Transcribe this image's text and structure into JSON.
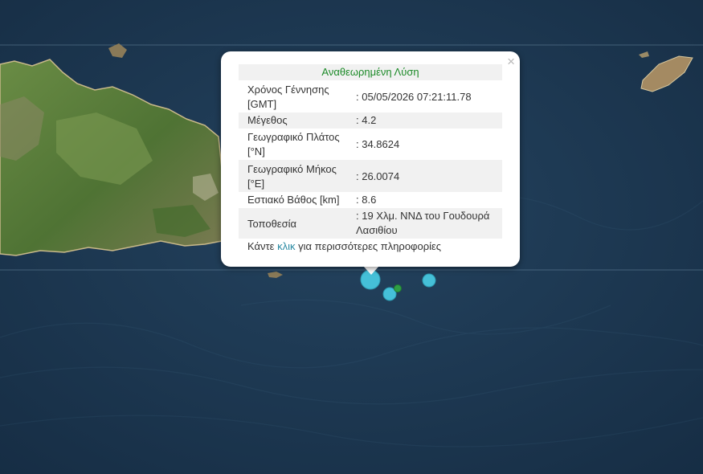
{
  "popup": {
    "title": "Αναθεωρημένη Λύση",
    "close_symbol": "×",
    "rows": [
      {
        "label": "Χρόνος Γέννησης [GMT]",
        "value": ": 05/05/2026 07:21:11.78"
      },
      {
        "label": "Μέγεθος",
        "value": ": 4.2"
      },
      {
        "label": "Γεωγραφικό Πλάτος [°N]",
        "value": ": 34.8624"
      },
      {
        "label": "Γεωγραφικό Μήκος [°E]",
        "value": ": 26.0074"
      },
      {
        "label": "Εστιακό Βάθος [km]",
        "value": ": 8.6"
      },
      {
        "label": "Τοποθεσία",
        "value": ": 19 Χλμ. ΝΝΔ του Γουδουρά Λασιθίου"
      }
    ],
    "more_prefix": "Κάντε ",
    "more_link": "κλικ",
    "more_suffix": " για περισσότερες πληροφορίες"
  },
  "colors": {
    "sea": "#1d3a55",
    "land": "#5b7f3a",
    "marker_blue": "#45c0d8",
    "marker_green": "#2f9e44",
    "title_green": "#1c8a28",
    "link": "#2a8aa3"
  },
  "markers": [
    {
      "type": "earthquake",
      "color": "blue",
      "size": "large"
    },
    {
      "type": "earthquake",
      "color": "blue",
      "size": "medium"
    },
    {
      "type": "earthquake",
      "color": "green",
      "size": "small"
    },
    {
      "type": "earthquake",
      "color": "blue",
      "size": "medium"
    }
  ]
}
